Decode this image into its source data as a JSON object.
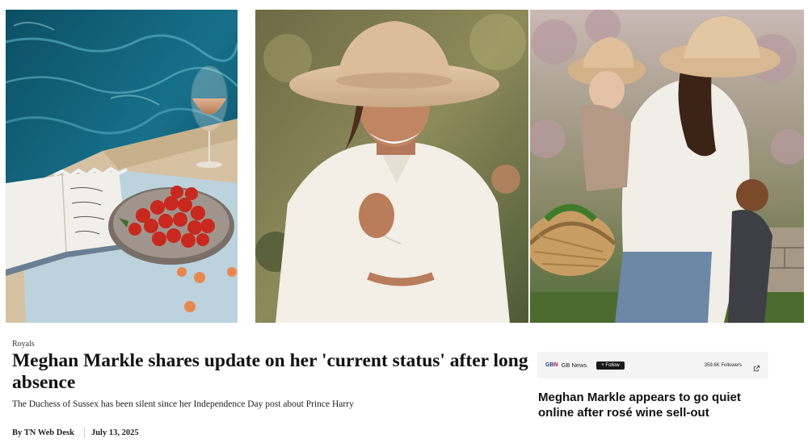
{
  "article": {
    "category": "Royals",
    "headline": "Meghan Markle shares update on her 'current status' after long absence",
    "subheadline": "The Duchess of Sussex has been silent since her Independence Day post about Prince Harry",
    "byline": "By TN Web Desk",
    "date": "July 13, 2025"
  },
  "related": {
    "source_logo_prefix": "GB",
    "source_logo_suffix": "N",
    "source_name": "GB News",
    "follow_label": "+ Follow",
    "followers": "359.6K Followers",
    "headline": "Meghan Markle appears to go quiet online after rosé wine sell-out"
  },
  "colors": {
    "logo_blue": "#1a3c8e",
    "logo_red": "#c8102e",
    "follow_bg": "#1a1a1a",
    "source_bar_bg": "#f4f4f4"
  },
  "icons": {
    "external": "external-link-icon"
  }
}
